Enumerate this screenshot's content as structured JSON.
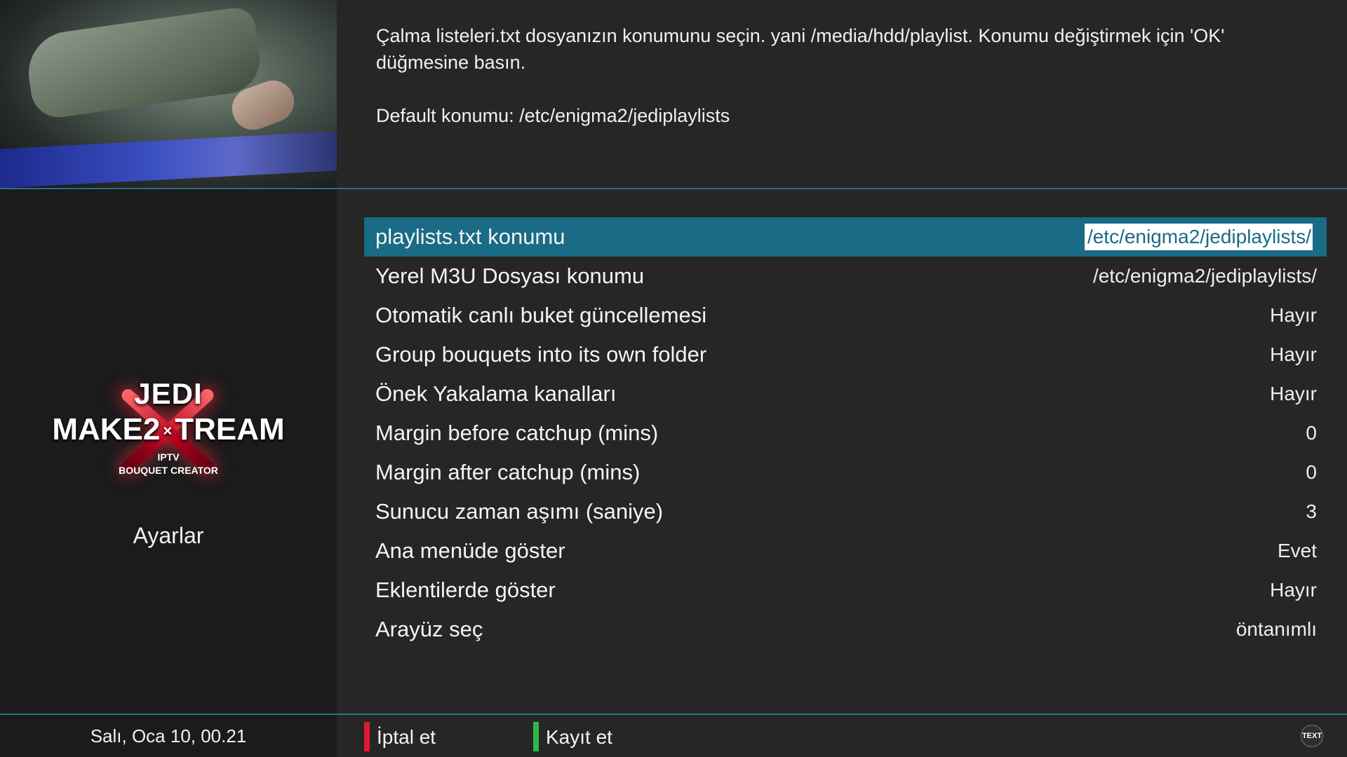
{
  "description": {
    "line1": "Çalma listeleri.txt dosyanızın konumunu seçin. yani /media/hdd/playlist. Konumu değiştirmek için 'OK' düğmesine basın.",
    "line2": "Default konumu: /etc/enigma2/jediplaylists"
  },
  "sidebar": {
    "logo": {
      "line1": "JEDI",
      "line2": "MAKE2",
      "line2b": "TREAM",
      "line3": "IPTV",
      "line4": "BOUQUET CREATOR"
    },
    "screen_title": "Ayarlar",
    "clock": "Salı, Oca 10, 00.21"
  },
  "settings": {
    "selected_index": 0,
    "items": [
      {
        "label": "playlists.txt konumu",
        "value": "/etc/enigma2/jediplaylists/"
      },
      {
        "label": "Yerel M3U Dosyası konumu",
        "value": "/etc/enigma2/jediplaylists/"
      },
      {
        "label": "Otomatik canlı buket güncellemesi",
        "value": "Hayır"
      },
      {
        "label": "Group bouquets into its own folder",
        "value": "Hayır"
      },
      {
        "label": "Önek Yakalama kanalları",
        "value": "Hayır"
      },
      {
        "label": "Margin before catchup (mins)",
        "value": "0"
      },
      {
        "label": "Margin after catchup (mins)",
        "value": "0"
      },
      {
        "label": "Sunucu zaman aşımı (saniye)",
        "value": "3"
      },
      {
        "label": "Ana menüde göster",
        "value": "Evet"
      },
      {
        "label": "Eklentilerde göster",
        "value": "Hayır"
      },
      {
        "label": "Arayüz seç",
        "value": "öntanımlı"
      }
    ]
  },
  "buttons": {
    "cancel": {
      "label": "İptal et",
      "color": "#e0192e"
    },
    "save": {
      "label": "Kayıt et",
      "color": "#2fb84a"
    }
  },
  "icons": {
    "text": {
      "name": "text-icon",
      "label": "TEXT"
    }
  },
  "colors": {
    "accent": "#1a6b85",
    "divider": "#2b6f86",
    "background": "#262626",
    "sidebar": "#1b1b1b"
  }
}
